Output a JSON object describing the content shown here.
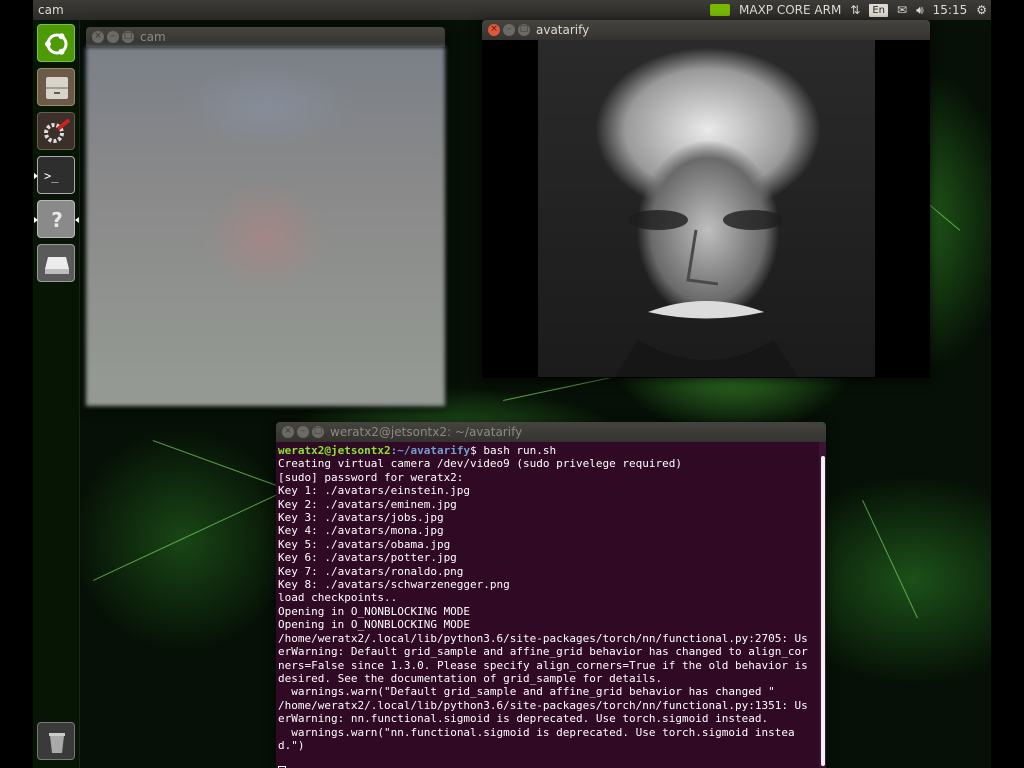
{
  "panel": {
    "active_app": "cam",
    "board_mode": "MAXP CORE ARM",
    "keyboard_layout": "En",
    "clock": "15:15"
  },
  "launcher": {
    "items": [
      {
        "name": "dash-home",
        "icon": "ubuntu-logo-icon"
      },
      {
        "name": "files",
        "icon": "file-cabinet-icon"
      },
      {
        "name": "settings",
        "icon": "settings-wrench-icon"
      },
      {
        "name": "terminal",
        "icon": "terminal-icon",
        "symbol": ">_"
      },
      {
        "name": "help",
        "icon": "help-question-icon",
        "symbol": "?"
      },
      {
        "name": "drive",
        "icon": "drive-icon"
      },
      {
        "name": "trash",
        "icon": "trash-icon"
      }
    ]
  },
  "windows": {
    "cam": {
      "title": "cam"
    },
    "avatarify": {
      "title": "avatarify"
    },
    "terminal": {
      "title": "weratx2@jetsontx2: ~/avatarify",
      "prompt_user": "weratx2@jetsontx2",
      "prompt_path": ":~/avatarify",
      "command": "$ bash run.sh",
      "lines": [
        "Creating virtual camera /dev/video9 (sudo privelege required)",
        "[sudo] password for weratx2:",
        "Key 1: ./avatars/einstein.jpg",
        "Key 2: ./avatars/eminem.jpg",
        "Key 3: ./avatars/jobs.jpg",
        "Key 4: ./avatars/mona.jpg",
        "Key 5: ./avatars/obama.jpg",
        "Key 6: ./avatars/potter.jpg",
        "Key 7: ./avatars/ronaldo.png",
        "Key 8: ./avatars/schwarzenegger.png",
        "load checkpoints..",
        "Opening in O_NONBLOCKING MODE",
        "Opening in O_NONBLOCKING MODE",
        "/home/weratx2/.local/lib/python3.6/site-packages/torch/nn/functional.py:2705: UserWarning: Default grid_sample and affine_grid behavior has changed to align_corners=False since 1.3.0. Please specify align_corners=True if the old behavior is desired. See the documentation of grid_sample for details.",
        "  warnings.warn(\"Default grid_sample and affine_grid behavior has changed \"",
        "/home/weratx2/.local/lib/python3.6/site-packages/torch/nn/functional.py:1351: UserWarning: nn.functional.sigmoid is deprecated. Use torch.sigmoid instead.",
        "  warnings.warn(\"nn.functional.sigmoid is deprecated. Use torch.sigmoid instead.\")"
      ]
    }
  },
  "colors": {
    "terminal_bg": "#300a24",
    "prompt_user": "#8ae234",
    "prompt_path": "#729fcf",
    "close_button": "#e0573b"
  }
}
